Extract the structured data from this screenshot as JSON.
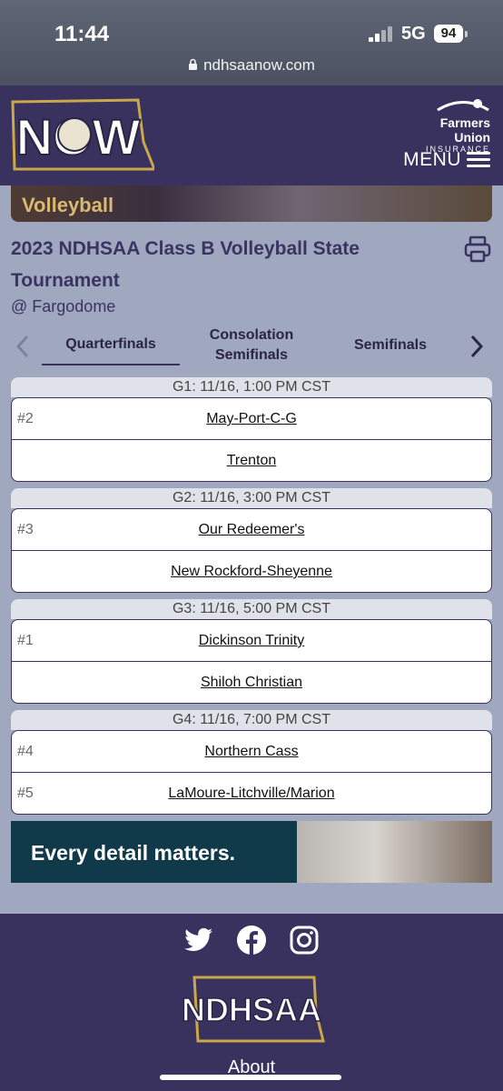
{
  "status": {
    "time": "11:44",
    "network": "5G",
    "battery": "94"
  },
  "browser": {
    "url": "ndhsaanow.com"
  },
  "header": {
    "logo_text": "NOW",
    "sponsor_line1": "Farmers Union",
    "sponsor_line2": "INSURANCE",
    "menu_label": "MENU"
  },
  "banner": {
    "sport_label": "Volleyball"
  },
  "event": {
    "title": "2023 NDHSAA Class B Volleyball State Tournament",
    "venue": "@ Fargodome"
  },
  "tabs": [
    {
      "label": "Quarterfinals",
      "active": true
    },
    {
      "label": "Consolation Semifinals",
      "active": false
    },
    {
      "label": "Semifinals",
      "active": false
    }
  ],
  "games": [
    {
      "header": "G1: 11/16, 1:00 PM CST",
      "teams": [
        {
          "seed": "#2",
          "name": "May-Port-C-G"
        },
        {
          "seed": "",
          "name": "Trenton"
        }
      ]
    },
    {
      "header": "G2: 11/16, 3:00 PM CST",
      "teams": [
        {
          "seed": "#3",
          "name": "Our Redeemer's"
        },
        {
          "seed": "",
          "name": "New Rockford-Sheyenne"
        }
      ]
    },
    {
      "header": "G3: 11/16, 5:00 PM CST",
      "teams": [
        {
          "seed": "#1",
          "name": "Dickinson Trinity"
        },
        {
          "seed": "",
          "name": "Shiloh Christian"
        }
      ]
    },
    {
      "header": "G4: 11/16, 7:00 PM CST",
      "teams": [
        {
          "seed": "#4",
          "name": "Northern Cass"
        },
        {
          "seed": "#5",
          "name": "LaMoure-Litchville/Marion"
        }
      ]
    }
  ],
  "ad": {
    "text": "Every detail matters."
  },
  "footer": {
    "logo_text": "NDHSAA",
    "about_label": "About",
    "social": [
      "twitter-icon",
      "facebook-icon",
      "instagram-icon"
    ]
  },
  "colors": {
    "brand": "#39325f",
    "page_bg": "#a0a8bf",
    "accent_gold": "#d8b873"
  }
}
